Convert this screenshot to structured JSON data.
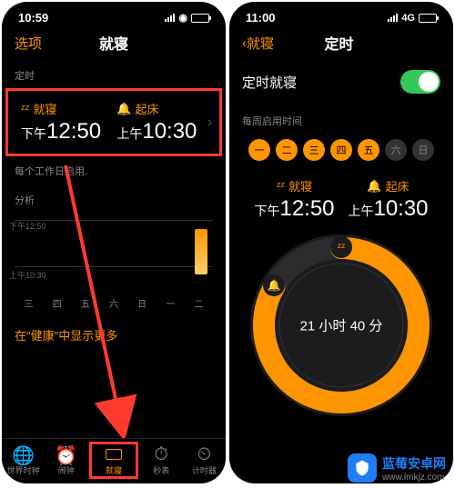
{
  "left": {
    "status_time": "10:59",
    "nav_left": "选项",
    "nav_title": "就寝",
    "section_timer": "定时",
    "bedtime_label": "就寝",
    "bedtime_prefix": "下午",
    "bedtime_time": "12:50",
    "wake_label": "起床",
    "wake_prefix": "上午",
    "wake_time": "10:30",
    "weekday_note": "每个工作日启用.",
    "analysis_label": "分析",
    "y_label_top": "下午12:50",
    "y_label_bot": "上午10:30",
    "days": [
      "三",
      "四",
      "五",
      "六",
      "日",
      "一",
      "二"
    ],
    "more_text": "在\"健康\"中显示更多",
    "tabs": [
      {
        "icon": "globe",
        "label": "世界时钟"
      },
      {
        "icon": "alarm",
        "label": "闹钟"
      },
      {
        "icon": "bed",
        "label": "就寝"
      },
      {
        "icon": "stopwatch",
        "label": "秒表"
      },
      {
        "icon": "timer",
        "label": "计时器"
      }
    ]
  },
  "right": {
    "status_time": "11:00",
    "status_network": "4G",
    "nav_back": "就寝",
    "nav_title": "定时",
    "toggle_label": "定时就寝",
    "week_label": "每周启用时间",
    "day_circles": [
      {
        "t": "一",
        "on": true
      },
      {
        "t": "二",
        "on": true
      },
      {
        "t": "三",
        "on": true
      },
      {
        "t": "四",
        "on": true
      },
      {
        "t": "五",
        "on": true
      },
      {
        "t": "六",
        "on": false
      },
      {
        "t": "日",
        "on": false
      }
    ],
    "bedtime_label": "就寝",
    "bedtime_prefix": "下午",
    "bedtime_time": "12:50",
    "wake_label": "起床",
    "wake_prefix": "上午",
    "wake_time": "10:30",
    "duration": "21 小时 40 分"
  },
  "watermark": {
    "name": "蓝莓安卓网",
    "url": "www.lmkjz.com"
  },
  "chart_data": {
    "type": "bar",
    "categories": [
      "三",
      "四",
      "五",
      "六",
      "日",
      "一",
      "二"
    ],
    "title": "分析",
    "ylabel_top": "下午12:50",
    "ylabel_bot": "上午10:30",
    "series": [
      {
        "name": "sleep",
        "values": [
          null,
          null,
          null,
          null,
          null,
          null,
          {
            "start": "下午12:50",
            "end": "上午10:30"
          }
        ]
      }
    ]
  }
}
